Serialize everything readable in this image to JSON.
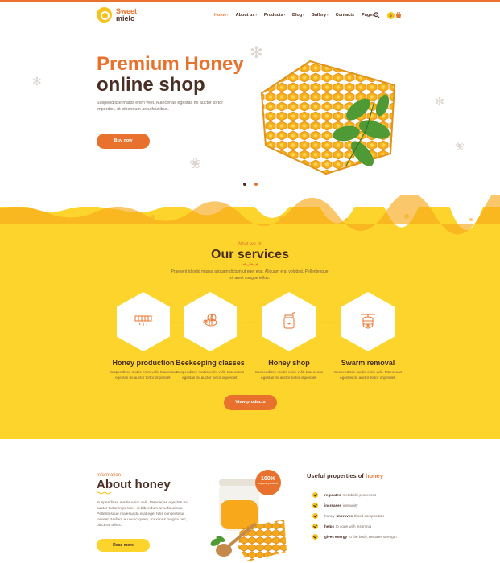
{
  "brand": {
    "line1": "Sweet",
    "line2": "mielo"
  },
  "nav": [
    {
      "label": "Home",
      "caret": true,
      "active": true
    },
    {
      "label": "About us",
      "caret": true
    },
    {
      "label": "Products",
      "caret": true
    },
    {
      "label": "Blog",
      "caret": true
    },
    {
      "label": "Gallery",
      "caret": true
    },
    {
      "label": "Contacts",
      "caret": false
    },
    {
      "label": "Pages",
      "caret": true
    }
  ],
  "cart": {
    "count": "0"
  },
  "hero": {
    "title_line1": "Premium Honey",
    "title_line2": "online shop",
    "description": "Suspendisse mattis enim velit. Maecenas egestas mi auctor tortor imperdiet, ut bibendum arcu faucibus.",
    "button": "Buy now"
  },
  "services": {
    "kicker": "What we do",
    "title": "Our services",
    "description": "Praesent id odio massa aliquam dictum ut eget erat. Aliquam erat volutpat. Pellentesque sit amet congue tellus.",
    "items": [
      {
        "title": "Honey production",
        "desc": "Suspendisse mattis enim velit. Maecenas egestas mi auctor tortor imperdiet."
      },
      {
        "title": "Beekeeping classes",
        "desc": "Suspendisse mattis enim velit. Maecenas egestas mi auctor tortor imperdiet."
      },
      {
        "title": "Honey shop",
        "desc": "Suspendisse mattis enim velit. Maecenas egestas mi auctor tortor imperdiet."
      },
      {
        "title": "Swarm removal",
        "desc": "Suspendisse mattis enim velit. Maecenas egestas mi auctor tortor imperdiet."
      }
    ],
    "button": "View products"
  },
  "about": {
    "kicker": "Information",
    "title": "About honey",
    "description": "Suspendisse mattis enim velit. Maecenas egestas mi auctor tortor imperdiet, ut bibendum arcu faucibus. Pellentesque malesuada erat eget felis consectetur laoreet. Nullam eu nunc quam, maximus magna nec, placerat tellus.",
    "button": "Read more",
    "badge_big": "100%",
    "badge_small": "organic product"
  },
  "properties": {
    "title_plain": "Useful properties of",
    "title_accent": "honey",
    "items": [
      {
        "bold": "regulates",
        "rest": "metabolic processes"
      },
      {
        "bold": "increases",
        "rest": "immunity"
      },
      {
        "pre": "honey",
        "bold": "improves",
        "rest": "blood composition"
      },
      {
        "bold": "helps",
        "rest": "to cope with insomnia"
      },
      {
        "bold": "gives energy",
        "rest": "to the body, restores strength"
      }
    ]
  },
  "colors": {
    "accent": "#e8722d",
    "yellow": "#fdd42c",
    "dark": "#4a2e23"
  }
}
